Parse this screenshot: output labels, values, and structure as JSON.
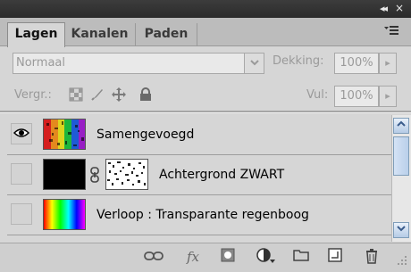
{
  "titlebar": {
    "collapse_glyph": "◂◂",
    "close_glyph": "×"
  },
  "tabs": [
    {
      "label": "Lagen",
      "active": true
    },
    {
      "label": "Kanalen",
      "active": false
    },
    {
      "label": "Paden",
      "active": false
    }
  ],
  "panel_menu_icon": "panel-menu-icon",
  "blend_mode": {
    "value": "Normaal"
  },
  "opacity": {
    "label": "Dekking:",
    "value": "100%"
  },
  "lock": {
    "label": "Vergr.:",
    "icons": [
      "lock-transparent-pixels-icon",
      "lock-image-pixels-icon",
      "lock-position-icon",
      "lock-all-icon"
    ]
  },
  "fill": {
    "label": "Vul:",
    "value": "100%"
  },
  "layers": [
    {
      "name": "Samengevoegd",
      "visible": true,
      "thumb": "merged-rainbow-noise"
    },
    {
      "name": "Achtergrond ZWART",
      "visible": false,
      "thumb": "black",
      "has_mask": true
    },
    {
      "name": "Verloop : Transparante regenboog",
      "visible": false,
      "thumb": "rainbow-gradient"
    }
  ],
  "footer_icons": [
    "link-layers-icon",
    "fx-icon",
    "add-mask-icon",
    "adjustment-layer-icon",
    "new-group-icon",
    "new-layer-icon",
    "delete-layer-icon"
  ]
}
